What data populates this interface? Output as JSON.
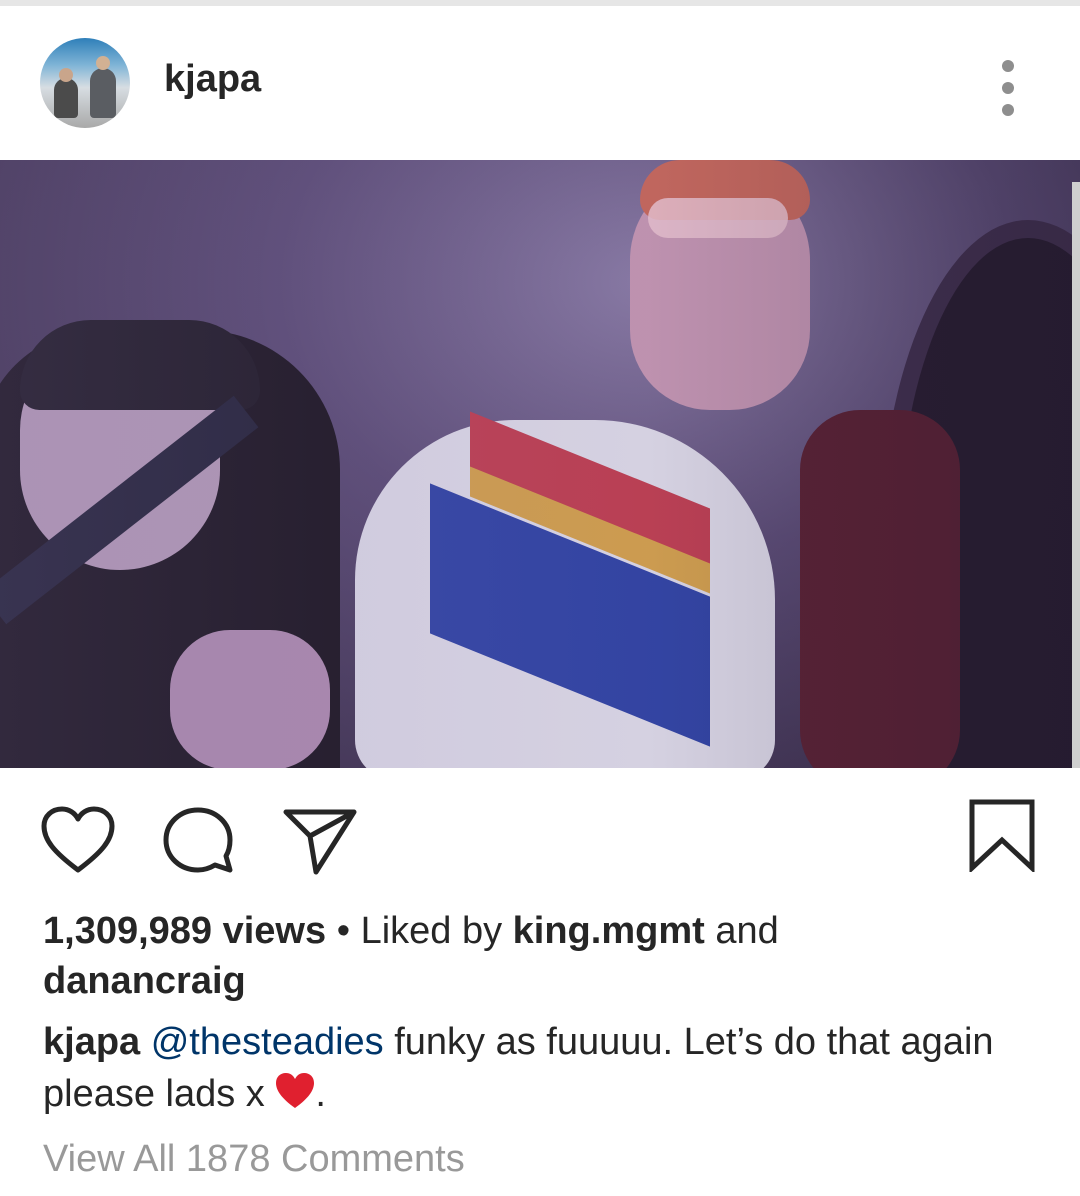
{
  "post": {
    "username": "kjapa",
    "more_icon": "more-vertical-icon"
  },
  "actions": {
    "like_icon": "heart-outline-icon",
    "comment_icon": "comment-icon",
    "share_icon": "send-icon",
    "save_icon": "bookmark-icon"
  },
  "stats": {
    "views": "1,309,989 views",
    "separator": " • ",
    "liked_by_prefix": "Liked by ",
    "liked_by_user1": "king.mgmt",
    "liked_by_and": " and",
    "liked_by_user2": "danancraig"
  },
  "caption": {
    "author": "kjapa",
    "mention": "@thesteadies",
    "text": "  funky as fuuuuu. Let’s do that again please lads x ",
    "emoji": "red-heart-emoji",
    "suffix": "."
  },
  "comments": {
    "view_all_label": "View All 1878 Comments"
  },
  "colors": {
    "text": "#262626",
    "mention": "#003569",
    "muted": "#999999",
    "heart": "#e0202f"
  }
}
